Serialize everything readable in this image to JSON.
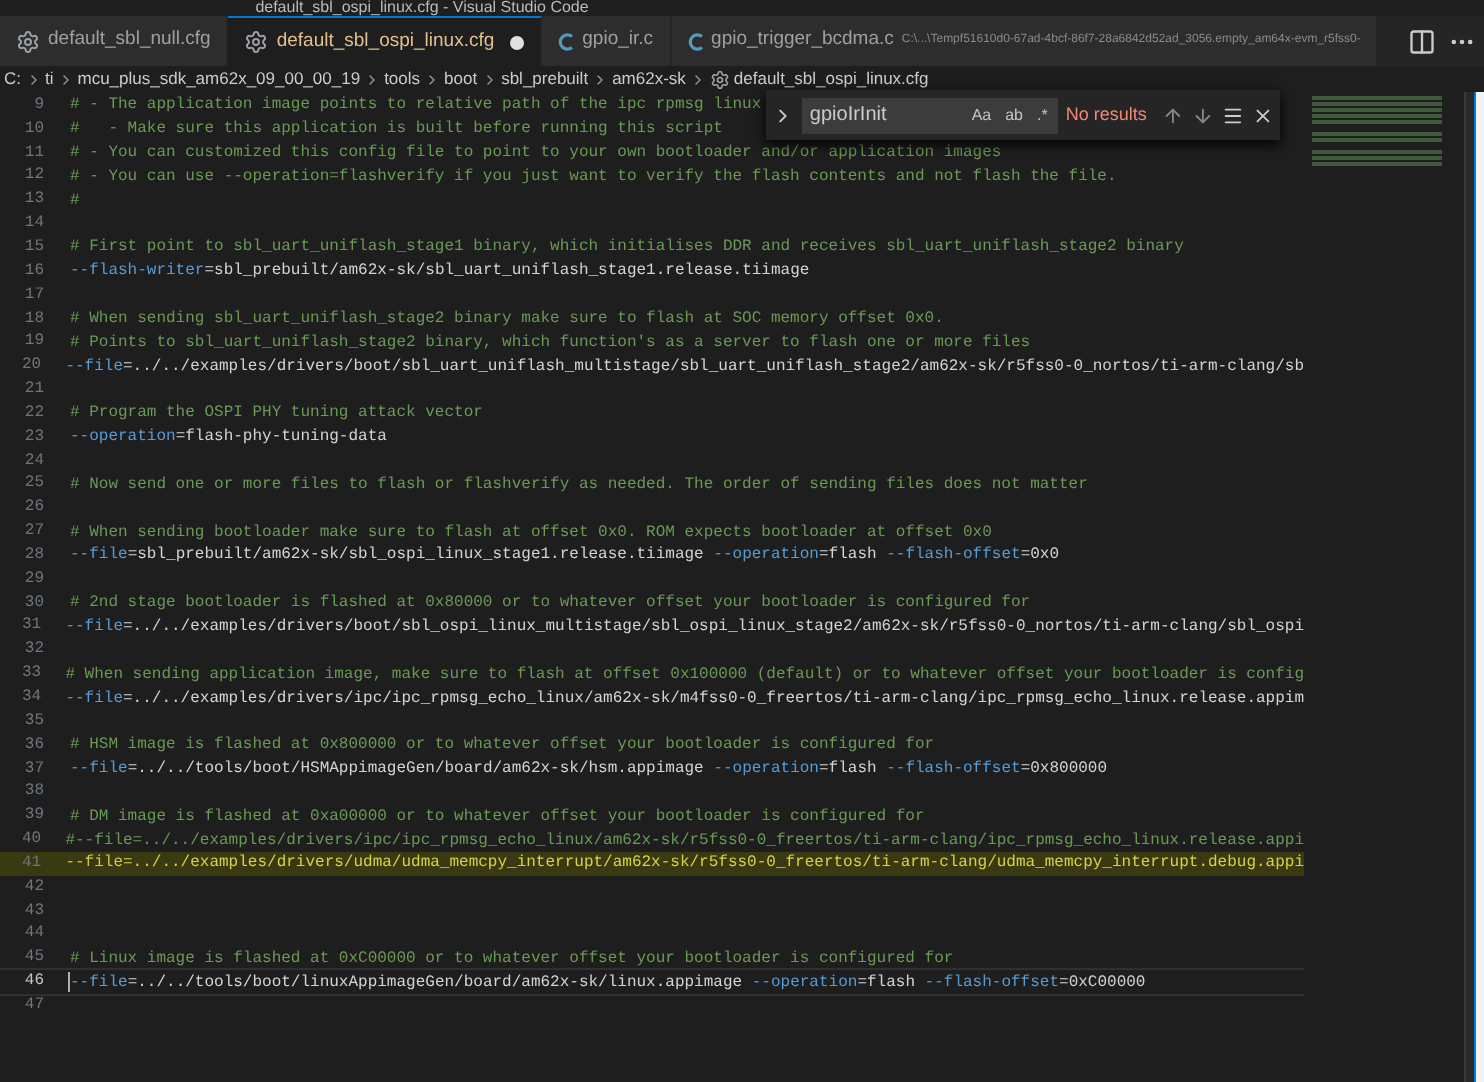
{
  "window": {
    "title": "default_sbl_ospi_linux.cfg - Visual Studio Code"
  },
  "tabs": [
    {
      "label": "default_sbl_null.cfg",
      "kind": "config",
      "selected": false,
      "modified": false
    },
    {
      "label": "default_sbl_ospi_linux.cfg",
      "kind": "config",
      "selected": true,
      "modified": true
    },
    {
      "label": "gpio_ir.c",
      "kind": "c",
      "selected": false,
      "modified": false
    },
    {
      "label": "gpio_trigger_bcdma.c",
      "kind": "c",
      "selected": false,
      "modified": false,
      "path": "C:\\...\\Tempf51610d0-67ad-4bcf-86f7-28a6842d52ad_3056.empty_am64x-evm_r5fss0-"
    }
  ],
  "breadcrumb": [
    "C:",
    "ti",
    "mcu_plus_sdk_am62x_09_00_00_19",
    "tools",
    "boot",
    "sbl_prebuilt",
    "am62x-sk",
    "default_sbl_ospi_linux.cfg"
  ],
  "find_widget": {
    "value": "gpioIrInit",
    "options": [
      {
        "label": "Aa",
        "on": false
      },
      {
        "label": "ab",
        "on": false
      },
      {
        "label": ".*",
        "on": false
      }
    ],
    "status": "No results"
  },
  "lines": [
    {
      "number": "9",
      "highlighted": false,
      "current": false,
      "tokens": [
        {
          "kind": "comment",
          "text": "# - The application image points to relative path of the ipc rpmsg linux"
        }
      ]
    },
    {
      "number": "10",
      "highlighted": false,
      "current": false,
      "tokens": [
        {
          "kind": "comment",
          "text": "#   - Make sure this application is built before running this script"
        }
      ]
    },
    {
      "number": "11",
      "highlighted": false,
      "current": false,
      "tokens": [
        {
          "kind": "comment",
          "text": "# - You can customized this config file to point to your own bootloader and/or application images"
        }
      ]
    },
    {
      "number": "12",
      "highlighted": false,
      "current": false,
      "tokens": [
        {
          "kind": "comment",
          "text": "# - You can use --operation=flashverify if you just want to verify the flash contents and not flash the file."
        }
      ]
    },
    {
      "number": "13",
      "highlighted": false,
      "current": false,
      "tokens": [
        {
          "kind": "comment",
          "text": "#"
        }
      ]
    },
    {
      "number": "14",
      "highlighted": false,
      "current": false
    },
    {
      "number": "15",
      "highlighted": false,
      "current": false,
      "tokens": [
        {
          "kind": "comment",
          "text": "# First point to sbl_uart_uniflash_stage1 binary, which initialises DDR and receives sbl_uart_uniflash_stage2 binary"
        }
      ]
    },
    {
      "number": "16",
      "highlighted": false,
      "current": false,
      "tokens": [
        {
          "kind": "key",
          "text": "--flash-writer"
        },
        {
          "kind": "text",
          "text": "=sbl_prebuilt/am62x-sk/sbl_uart_uniflash_stage1.release.tiimage"
        }
      ]
    },
    {
      "number": "17",
      "highlighted": false,
      "current": false
    },
    {
      "number": "18",
      "highlighted": false,
      "current": false,
      "tokens": [
        {
          "kind": "comment",
          "text": "# When sending sbl_uart_uniflash_stage2 binary make sure to flash at SOC memory offset 0x0."
        }
      ]
    },
    {
      "number": "19",
      "highlighted": false,
      "current": false,
      "tokens": [
        {
          "kind": "comment",
          "text": "# Points to sbl_uart_uniflash_stage2 binary, which function's as a server to flash one or more files"
        }
      ]
    },
    {
      "number": "20",
      "highlighted": false,
      "current": false,
      "tokens": [
        {
          "kind": "key",
          "text": "--file"
        },
        {
          "kind": "text",
          "text": "=../../examples/drivers/boot/sbl_uart_uniflash_multistage/sbl_uart_uniflash_stage2/am62x-sk/r5fss0-0_nortos/ti-arm-clang/sb"
        }
      ]
    },
    {
      "number": "21",
      "highlighted": false,
      "current": false
    },
    {
      "number": "22",
      "highlighted": false,
      "current": false,
      "tokens": [
        {
          "kind": "comment",
          "text": "# Program the OSPI PHY tuning attack vector"
        }
      ]
    },
    {
      "number": "23",
      "highlighted": false,
      "current": false,
      "tokens": [
        {
          "kind": "key",
          "text": "--operation"
        },
        {
          "kind": "text",
          "text": "=flash-phy-tuning-data"
        }
      ]
    },
    {
      "number": "24",
      "highlighted": false,
      "current": false
    },
    {
      "number": "25",
      "highlighted": false,
      "current": false,
      "tokens": [
        {
          "kind": "comment",
          "text": "# Now send one or more files to flash or flashverify as needed. The order of sending files does not matter"
        }
      ]
    },
    {
      "number": "26",
      "highlighted": false,
      "current": false
    },
    {
      "number": "27",
      "highlighted": false,
      "current": false,
      "tokens": [
        {
          "kind": "comment",
          "text": "# When sending bootloader make sure to flash at offset 0x0. ROM expects bootloader at offset 0x0"
        }
      ]
    },
    {
      "number": "28",
      "highlighted": false,
      "current": false,
      "tokens": [
        {
          "kind": "key",
          "text": "--file"
        },
        {
          "kind": "text",
          "text": "=sbl_prebuilt/am62x-sk/sbl_ospi_linux_stage1.release.tiimage "
        },
        {
          "kind": "key",
          "text": "--operation"
        },
        {
          "kind": "text",
          "text": "=flash "
        },
        {
          "kind": "key",
          "text": "--flash-offset"
        },
        {
          "kind": "text",
          "text": "=0x0"
        }
      ]
    },
    {
      "number": "29",
      "highlighted": false,
      "current": false
    },
    {
      "number": "30",
      "highlighted": false,
      "current": false,
      "tokens": [
        {
          "kind": "comment",
          "text": "# 2nd stage bootloader is flashed at 0x80000 or to whatever offset your bootloader is configured for"
        }
      ]
    },
    {
      "number": "31",
      "highlighted": false,
      "current": false,
      "tokens": [
        {
          "kind": "key",
          "text": "--file"
        },
        {
          "kind": "text",
          "text": "=../../examples/drivers/boot/sbl_ospi_linux_multistage/sbl_ospi_linux_stage2/am62x-sk/r5fss0-0_nortos/ti-arm-clang/sbl_ospi"
        }
      ]
    },
    {
      "number": "32",
      "highlighted": false,
      "current": false
    },
    {
      "number": "33",
      "highlighted": false,
      "current": false,
      "tokens": [
        {
          "kind": "comment",
          "text": "# When sending application image, make sure to flash at offset 0x100000 (default) or to whatever offset your bootloader is config"
        }
      ]
    },
    {
      "number": "34",
      "highlighted": false,
      "current": false,
      "tokens": [
        {
          "kind": "key",
          "text": "--file"
        },
        {
          "kind": "text",
          "text": "=../../examples/drivers/ipc/ipc_rpmsg_echo_linux/am62x-sk/m4fss0-0_freertos/ti-arm-clang/ipc_rpmsg_echo_linux.release.appim"
        }
      ]
    },
    {
      "number": "35",
      "highlighted": false,
      "current": false
    },
    {
      "number": "36",
      "highlighted": false,
      "current": false,
      "tokens": [
        {
          "kind": "comment",
          "text": "# HSM image is flashed at 0x800000 or to whatever offset your bootloader is configured for"
        }
      ]
    },
    {
      "number": "37",
      "highlighted": false,
      "current": false,
      "tokens": [
        {
          "kind": "key",
          "text": "--file"
        },
        {
          "kind": "text",
          "text": "=../../tools/boot/HSMAppimageGen/board/am62x-sk/hsm.appimage "
        },
        {
          "kind": "key",
          "text": "--operation"
        },
        {
          "kind": "text",
          "text": "=flash "
        },
        {
          "kind": "key",
          "text": "--flash-offset"
        },
        {
          "kind": "text",
          "text": "=0x800000"
        }
      ]
    },
    {
      "number": "38",
      "highlighted": false,
      "current": false
    },
    {
      "number": "39",
      "highlighted": false,
      "current": false,
      "tokens": [
        {
          "kind": "comment",
          "text": "# DM image is flashed at 0xa00000 or to whatever offset your bootloader is configured for"
        }
      ]
    },
    {
      "number": "40",
      "highlighted": false,
      "current": false,
      "tokens": [
        {
          "kind": "comment",
          "text": "#--file=../../examples/drivers/ipc/ipc_rpmsg_echo_linux/am62x-sk/r5fss0-0_freertos/ti-arm-clang/ipc_rpmsg_echo_linux.release.appi"
        }
      ]
    },
    {
      "number": "41",
      "highlighted": true,
      "current": false,
      "tokens": [
        {
          "kind": "key",
          "text": "--file"
        },
        {
          "kind": "text",
          "text": "=../../examples/drivers/udma/udma_memcpy_interrupt/am62x-sk/r5fss0-0_freertos/ti-arm-clang/udma_memcpy_interrupt.debug.appi"
        }
      ]
    },
    {
      "number": "42",
      "highlighted": false,
      "current": false
    },
    {
      "number": "43",
      "highlighted": false,
      "current": false
    },
    {
      "number": "44",
      "highlighted": false,
      "current": false
    },
    {
      "number": "45",
      "highlighted": false,
      "current": false,
      "tokens": [
        {
          "kind": "comment",
          "text": "# Linux image is flashed at 0xC00000 or to whatever offset your bootloader is configured for"
        }
      ]
    },
    {
      "number": "46",
      "highlighted": false,
      "current": true,
      "tokens": [
        {
          "kind": "key",
          "text": "--file"
        },
        {
          "kind": "text",
          "text": "=../../tools/boot/linuxAppimageGen/board/am62x-sk/linux.appimage "
        },
        {
          "kind": "key",
          "text": "--operation"
        },
        {
          "kind": "text",
          "text": "=flash "
        },
        {
          "kind": "key",
          "text": "--flash-offset"
        },
        {
          "kind": "text",
          "text": "=0xC00000"
        }
      ]
    },
    {
      "number": "47",
      "highlighted": false,
      "current": false
    }
  ]
}
